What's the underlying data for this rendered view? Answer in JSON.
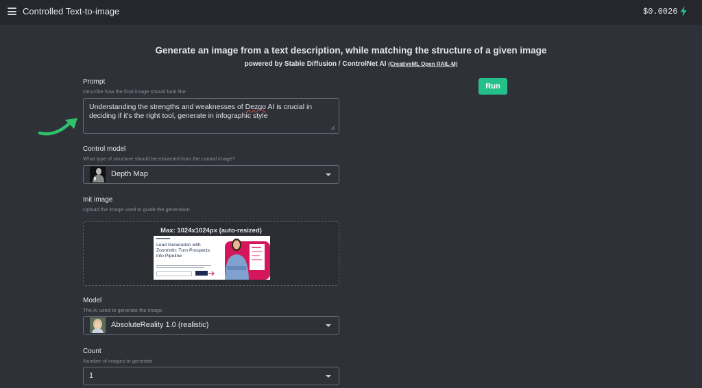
{
  "header": {
    "title": "Controlled Text-to-image",
    "balance": "$0.0026",
    "menu_icon": "hamburger-menu-icon",
    "bolt_icon": "lightning-bolt-icon"
  },
  "intro": {
    "heading": "Generate an image from a text description, while matching the structure of a given image",
    "powered_by": "powered by Stable Diffusion / ControlNet AI",
    "license_link": "(CreativeML Open RAIL-M)"
  },
  "run_button": "Run",
  "prompt": {
    "label": "Prompt",
    "hint": "Describe how the final image should look like",
    "value_before": "Understanding the strengths and weaknesses of ",
    "value_misspelled": "Dezgo",
    "value_after": " AI is crucial in deciding if it's the right tool, generate in infographic style"
  },
  "control_model": {
    "label": "Control model",
    "hint": "What type of structure should be extracted from the control image?",
    "selected": "Depth Map"
  },
  "init_image": {
    "label": "Init image",
    "hint": "Upload the image used to guide the generation",
    "max_size": "Max: 1024x1024px (auto-resized)",
    "preview_headline": "Lead Generation with ZoomInfo: Turn Prospects into Pipeline"
  },
  "model": {
    "label": "Model",
    "hint": "The AI used to generate the image.",
    "selected": "AbsoluteReality 1.0 (realistic)"
  },
  "count": {
    "label": "Count",
    "hint": "Number of images to generate",
    "selected": "1"
  },
  "colors": {
    "background": "#2f3138",
    "topbar": "#25272d",
    "accent": "#25c08a",
    "input_border": "#6c6f77"
  }
}
